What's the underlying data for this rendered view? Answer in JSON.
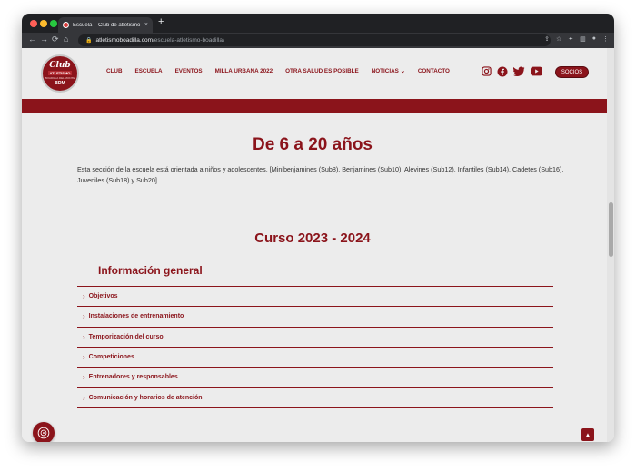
{
  "browser": {
    "tab_title": "Escuela – Club de atletismo Bo",
    "tab_close": "×",
    "new_tab": "+",
    "url_host": "atletismoboadilla.com",
    "url_path": "/escuela-atletismo-boadilla/",
    "nav": {
      "back": "←",
      "forward": "→",
      "reload": "⟳",
      "home": "⌂"
    }
  },
  "site": {
    "logo": {
      "line1": "Club",
      "line2": "ATLETISMO",
      "line3": "BOADILLA DEL MONTE",
      "line4": "BDM"
    },
    "menu": [
      "CLUB",
      "ESCUELA",
      "EVENTOS",
      "MILLA URBANA 2022",
      "OTRA SALUD ES POSIBLE",
      "NOTICIAS ⌄",
      "CONTACTO"
    ],
    "social_icons": [
      "instagram-icon",
      "facebook-icon",
      "twitter-icon",
      "youtube-icon"
    ],
    "socios_label": "SOCIOS",
    "brand_color": "#8b141b"
  },
  "content": {
    "heading": "De 6 a 20 años",
    "intro": "Esta sección de la escuela está orientada a niños y adolescentes, [Minibenjamines (Sub8), Benjamines (Sub10), Alevines (Sub12), Infantiles (Sub14), Cadetes (Sub16), Juveniles (Sub18) y Sub20].",
    "course": "Curso 2023 - 2024",
    "section_title": "Información general",
    "accordion": [
      "Objetivos",
      "Instalaciones de entrenamiento",
      "Temporización del curso",
      "Competiciones",
      "Entrenadores y responsables",
      "Comunicación y horarios de atención"
    ],
    "chevron": "›"
  },
  "widgets": {
    "back_to_top": "▲"
  }
}
